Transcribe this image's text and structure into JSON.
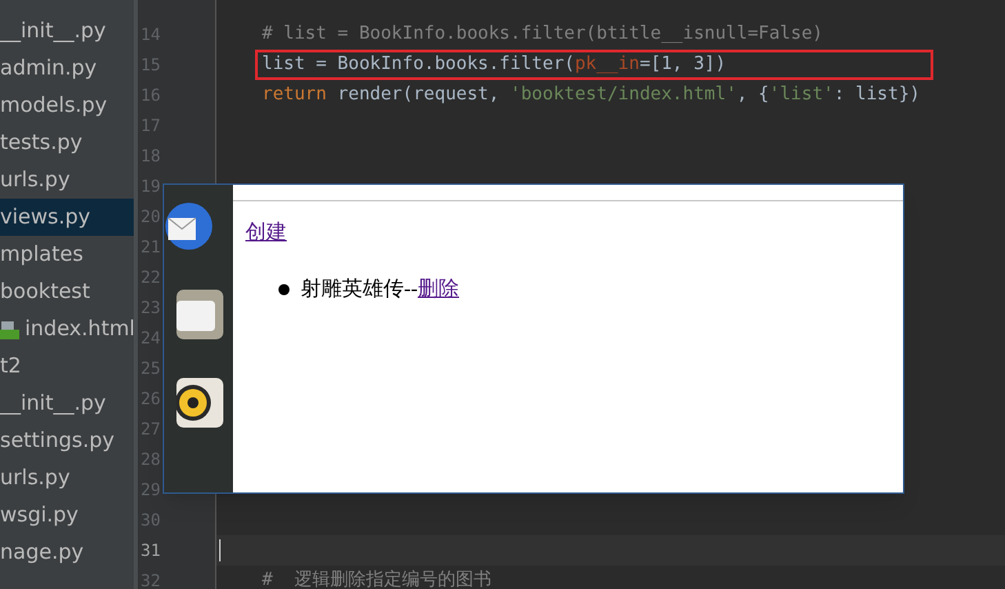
{
  "project_tree": {
    "items": [
      {
        "label": "__init__.py",
        "selected": false
      },
      {
        "label": "admin.py",
        "selected": false
      },
      {
        "label": "models.py",
        "selected": false
      },
      {
        "label": "tests.py",
        "selected": false
      },
      {
        "label": "urls.py",
        "selected": false
      },
      {
        "label": "views.py",
        "selected": true
      },
      {
        "label": "mplates",
        "selected": false,
        "children": [
          {
            "label": "booktest",
            "selected": false,
            "children": [
              {
                "label": "index.html",
                "selected": false
              }
            ]
          }
        ]
      },
      {
        "label": "t2",
        "selected": false,
        "children": [
          {
            "label": "__init__.py",
            "selected": false
          },
          {
            "label": "settings.py",
            "selected": false
          },
          {
            "label": "urls.py",
            "selected": false
          },
          {
            "label": "wsgi.py",
            "selected": false
          }
        ]
      },
      {
        "label": "nage.py",
        "selected": false
      }
    ]
  },
  "editor": {
    "lines": [
      {
        "number": "14",
        "boxed": false,
        "current": false,
        "tokens": [
          {
            "kind": "comment",
            "text": "# list = BookInfo.books.filter(btitle__isnull=False)"
          }
        ]
      },
      {
        "number": "15",
        "boxed": true,
        "current": false,
        "tokens": [
          {
            "kind": "plain",
            "text": "list = BookInfo.books.filter("
          },
          {
            "kind": "param",
            "text": "pk__in"
          },
          {
            "kind": "plain",
            "text": "=[1, 3])"
          }
        ]
      },
      {
        "number": "16",
        "boxed": false,
        "current": false,
        "tokens": [
          {
            "kind": "keyword",
            "text": "return "
          },
          {
            "kind": "plain",
            "text": "render(request, "
          },
          {
            "kind": "string",
            "text": "'booktest/index.html'"
          },
          {
            "kind": "plain",
            "text": ", {"
          },
          {
            "kind": "string",
            "text": "'list'"
          },
          {
            "kind": "plain",
            "text": ": list})"
          }
        ]
      },
      {
        "number": "17",
        "boxed": false,
        "current": false
      },
      {
        "number": "18",
        "boxed": false,
        "current": false
      },
      {
        "number": "19",
        "boxed": false,
        "current": false
      },
      {
        "number": "20",
        "boxed": false,
        "current": false
      },
      {
        "number": "21",
        "boxed": false,
        "current": false
      },
      {
        "number": "22",
        "boxed": false,
        "current": false
      },
      {
        "number": "23",
        "boxed": false,
        "current": false
      },
      {
        "number": "24",
        "boxed": false,
        "current": false
      },
      {
        "number": "25",
        "boxed": false,
        "current": false
      },
      {
        "number": "26",
        "boxed": false,
        "current": false
      },
      {
        "number": "27",
        "boxed": false,
        "current": false
      },
      {
        "number": "28",
        "boxed": false,
        "current": false
      },
      {
        "number": "29",
        "boxed": false,
        "current": false
      },
      {
        "number": "30",
        "boxed": false,
        "current": false
      },
      {
        "number": "31",
        "boxed": false,
        "current": true
      },
      {
        "number": "32",
        "boxed": false,
        "current": false,
        "tokens": [
          {
            "kind": "comment",
            "text": "#  逻辑删除指定编号的图书"
          }
        ]
      }
    ]
  },
  "browser": {
    "create_link": "创建",
    "items": [
      {
        "text": "射雕英雄传--",
        "link": "删除"
      }
    ]
  }
}
